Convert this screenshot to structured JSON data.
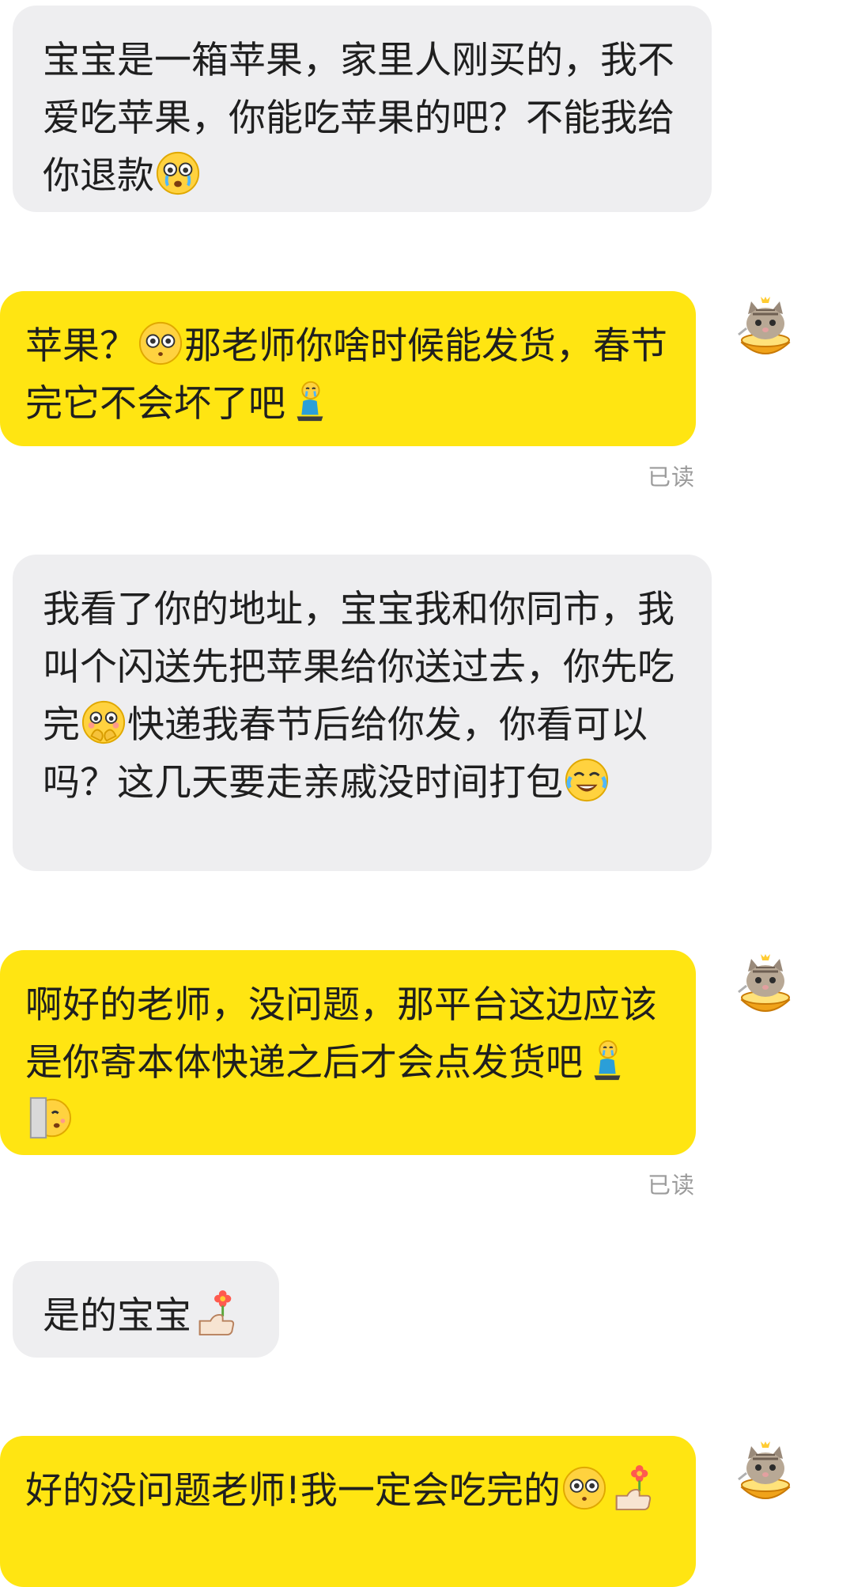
{
  "messages": [
    {
      "id": "m1",
      "direction": "incoming",
      "parts": [
        {
          "type": "text",
          "value": "宝宝是一箱苹果，家里人刚买的，我不爱吃苹果，你能吃苹果的吧？不能我给你退款"
        },
        {
          "type": "emoji",
          "icon": "crying-face-icon"
        }
      ]
    },
    {
      "id": "m2",
      "direction": "outgoing",
      "read_label": "已读",
      "avatar": "cat-in-egg-tart-avatar-icon",
      "parts": [
        {
          "type": "text",
          "value": "苹果？"
        },
        {
          "type": "emoji",
          "icon": "wide-eyed-face-icon"
        },
        {
          "type": "text",
          "value": "那老师你啥时候能发货，春节完它不会坏了吧"
        },
        {
          "type": "emoji",
          "icon": "kneeling-crying-person-icon"
        }
      ]
    },
    {
      "id": "m3",
      "direction": "incoming",
      "parts": [
        {
          "type": "text",
          "value": "我看了你的地址，宝宝我和你同市，我叫个闪送先把苹果给你送过去，你先吃完"
        },
        {
          "type": "emoji",
          "icon": "pleading-hands-face-icon"
        },
        {
          "type": "text",
          "value": "快递我春节后给你发，你看可以吗？这几天要走亲戚没时间打包"
        },
        {
          "type": "emoji",
          "icon": "tears-of-joy-face-icon"
        }
      ]
    },
    {
      "id": "m4",
      "direction": "outgoing",
      "read_label": "已读",
      "avatar": "cat-in-egg-tart-avatar-icon",
      "parts": [
        {
          "type": "text",
          "value": "啊好的老师，没问题，那平台这边应该是你寄本体快递之后才会点发货吧"
        },
        {
          "type": "emoji",
          "icon": "kneeling-crying-person-icon"
        },
        {
          "type": "emoji",
          "icon": "peeking-door-face-icon"
        }
      ]
    },
    {
      "id": "m5",
      "direction": "incoming",
      "parts": [
        {
          "type": "text",
          "value": "是的宝宝"
        },
        {
          "type": "emoji",
          "icon": "thumbs-up-flower-icon"
        }
      ]
    },
    {
      "id": "m6",
      "direction": "outgoing",
      "avatar": "cat-in-egg-tart-avatar-icon",
      "parts": [
        {
          "type": "text",
          "value": "好的没问题老师!我一定会吃完的"
        },
        {
          "type": "emoji",
          "icon": "wide-eyed-face-icon"
        },
        {
          "type": "emoji",
          "icon": "thumbs-up-flower-icon"
        }
      ]
    }
  ],
  "colors": {
    "incoming_bubble": "#eeeef0",
    "outgoing_bubble": "#ffe512",
    "read_text": "#9b9b9b",
    "text": "#1f1f1f"
  }
}
